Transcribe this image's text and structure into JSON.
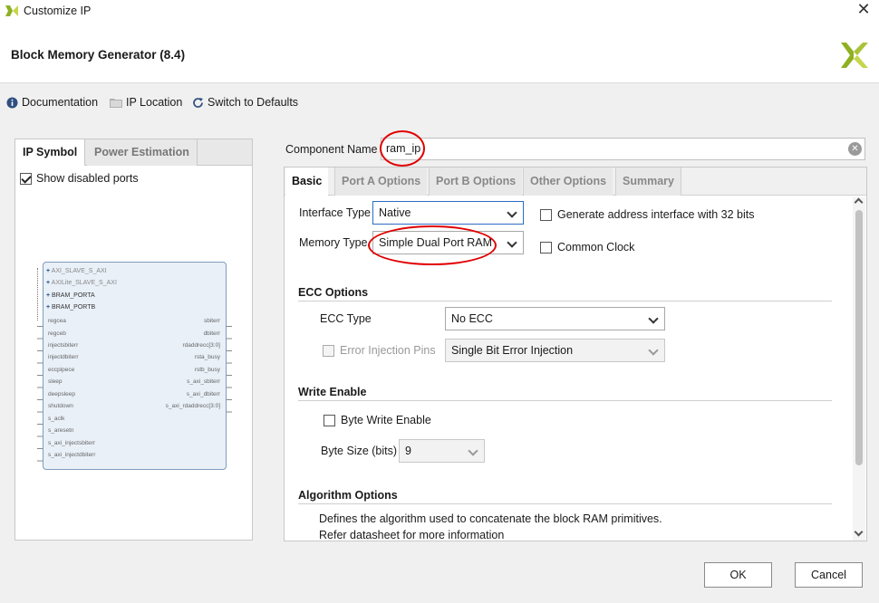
{
  "window": {
    "title": "Customize IP"
  },
  "header": {
    "title": "Block Memory Generator (8.4)"
  },
  "toolbar": {
    "documentation": "Documentation",
    "ip_location": "IP Location",
    "switch_defaults": "Switch to Defaults"
  },
  "left_panel": {
    "tabs": [
      "IP Symbol",
      "Power Estimation"
    ],
    "show_disabled_ports": {
      "label": "Show disabled ports",
      "checked": true
    },
    "symbol": {
      "buses": [
        "AXI_SLAVE_S_AXI",
        "AXILite_SLAVE_S_AXI",
        "BRAM_PORTA",
        "BRAM_PORTB"
      ],
      "left_ports": [
        "regcea",
        "regceb",
        "injectsbiterr",
        "injectdbiterr",
        "eccpipece",
        "sleep",
        "deepsleep",
        "shutdown",
        "s_aclk",
        "s_aresetn",
        "s_axi_injectsbiterr",
        "s_axi_injectdbiterr"
      ],
      "right_ports": [
        "sbiterr",
        "dbiterr",
        "rdaddrecc[3:0]",
        "rsta_busy",
        "rstb_busy",
        "s_axi_sbiterr",
        "s_axi_dbiterr",
        "s_axi_rdaddrecc[3:0]"
      ]
    }
  },
  "component": {
    "label": "Component Name",
    "value": "ram_ip"
  },
  "tabs": [
    "Basic",
    "Port A Options",
    "Port B Options",
    "Other Options",
    "Summary"
  ],
  "basic": {
    "interface_type": {
      "label": "Interface Type",
      "value": "Native"
    },
    "memory_type": {
      "label": "Memory Type",
      "value": "Simple Dual Port RAM"
    },
    "gen_addr_32": {
      "label": "Generate address interface with 32 bits",
      "checked": false
    },
    "common_clock": {
      "label": "Common Clock",
      "checked": false
    },
    "ecc_section": "ECC Options",
    "ecc_type": {
      "label": "ECC Type",
      "value": "No ECC"
    },
    "error_injection": {
      "label": "Error Injection Pins",
      "value": "Single Bit Error Injection"
    },
    "write_enable_section": "Write Enable",
    "byte_write_enable": {
      "label": "Byte Write Enable",
      "checked": false
    },
    "byte_size": {
      "label": "Byte Size (bits)",
      "value": "9"
    },
    "algorithm_section": "Algorithm Options",
    "algorithm_text1": "Defines the algorithm used to concatenate the block RAM primitives.",
    "algorithm_text2": "Refer datasheet for more information"
  },
  "buttons": {
    "ok": "OK",
    "cancel": "Cancel"
  },
  "colors": {
    "annotation_red": "#e00000",
    "focus_blue": "#2b6cc4",
    "brand_green": "#8fb021"
  }
}
